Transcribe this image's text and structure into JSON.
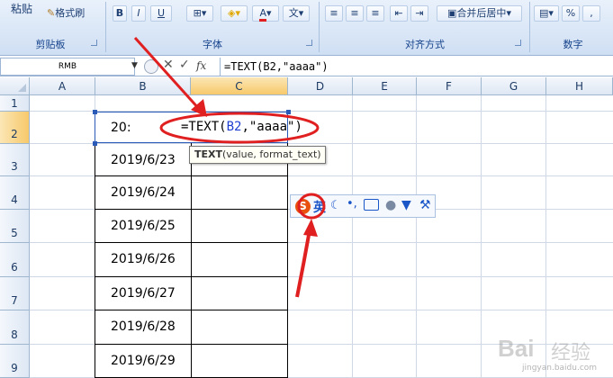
{
  "ribbon": {
    "paste_label": "粘贴",
    "format_painter_label": "格式刷",
    "clipboard_label": "剪贴板",
    "bold": "B",
    "italic": "I",
    "underline": "U",
    "font_color_letter": "A",
    "font_label": "字体",
    "merge_center_label": "合并后居中",
    "alignment_label": "对齐方式",
    "number_label": "数字",
    "percent_symbol": "%",
    "comma_symbol": ","
  },
  "formula_bar": {
    "name_box": "RMB",
    "fx_label": "fx",
    "formula": "=TEXT(B2,\"aaaa\")"
  },
  "columns": [
    "A",
    "B",
    "C",
    "D",
    "E",
    "F",
    "G",
    "H"
  ],
  "rows": [
    "1",
    "2",
    "3",
    "4",
    "5",
    "6",
    "7",
    "8",
    "9"
  ],
  "cells": {
    "b2": "20:",
    "c2_ref": "B2",
    "b3": "2019/6/23",
    "b4": "2019/6/24",
    "b5": "2019/6/25",
    "b6": "2019/6/26",
    "b7": "2019/6/27",
    "b8": "2019/6/28",
    "b9": "2019/6/29"
  },
  "tooltip": {
    "func": "TEXT",
    "args": "(value, format_text)"
  },
  "ime": {
    "mode_char": "英"
  },
  "watermark": {
    "brand": "Bai",
    "cn": "经验",
    "url": "jingyan.baidu.com"
  },
  "colors": {
    "annotation": "#e02020",
    "ref_blue": "#1f3fd0"
  }
}
